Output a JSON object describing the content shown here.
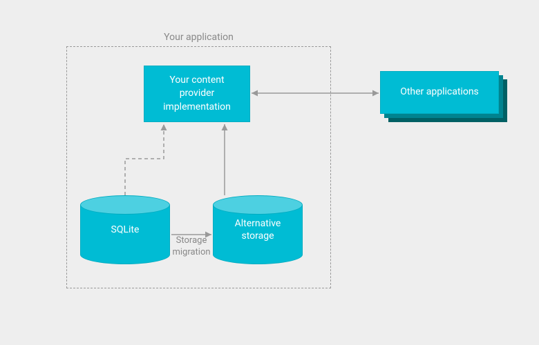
{
  "container": {
    "label": "Your application"
  },
  "nodes": {
    "provider": {
      "label": "Your content\nprovider\nimplementation"
    },
    "other_apps": {
      "label": "Other applications"
    },
    "sqlite": {
      "label": "SQLite"
    },
    "alt_storage": {
      "label": "Alternative\nstorage"
    }
  },
  "edges": {
    "migration": {
      "label": "Storage\nmigration"
    }
  },
  "colors": {
    "node_fill": "#00bcd4",
    "node_top": "#4dd0e1",
    "node_border": "#00acc1",
    "shadow": "#006064",
    "bg": "#eeeeee",
    "arrow": "#999999",
    "text_muted": "#888888"
  }
}
